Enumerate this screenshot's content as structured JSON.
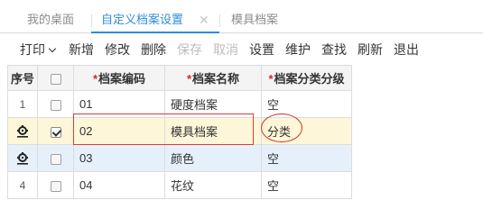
{
  "tabs": [
    {
      "label": "我的桌面"
    },
    {
      "label": "自定义档案设置"
    },
    {
      "label": "模具档案"
    }
  ],
  "tab_close_glyph": "✕",
  "toolbar": {
    "print": "打印",
    "add": "新增",
    "edit": "修改",
    "delete": "删除",
    "save": "保存",
    "cancel": "取消",
    "settings": "设置",
    "maintain": "维护",
    "find": "查找",
    "refresh": "刷新",
    "exit": "退出"
  },
  "grid": {
    "headers": {
      "seq": "序号",
      "code": "档案编码",
      "name": "档案名称",
      "classify": "档案分类分级"
    },
    "required_mark": "*",
    "rows": [
      {
        "seq": "1",
        "checked": false,
        "code": "01",
        "name": "硬度档案",
        "classify": "空"
      },
      {
        "seq": "",
        "checked": true,
        "code": "02",
        "name": "模具档案",
        "classify": "分类"
      },
      {
        "seq": "",
        "checked": false,
        "code": "03",
        "name": "颜色",
        "classify": "空"
      },
      {
        "seq": "4",
        "checked": false,
        "code": "04",
        "name": "花纹",
        "classify": "空"
      }
    ]
  },
  "colors": {
    "accent": "#2f8dde",
    "selected_row": "#fdf6d8",
    "hover_row": "#e6f0fa",
    "annotation": "#e03a3a",
    "required": "#e02020"
  }
}
